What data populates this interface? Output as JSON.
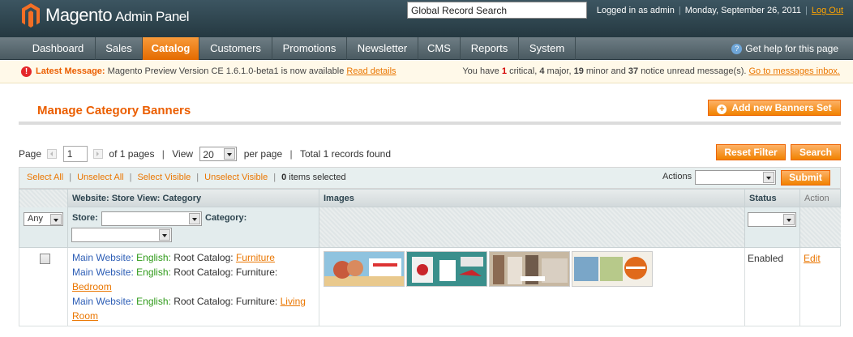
{
  "header": {
    "brand": "Magento",
    "brand_sub": "Admin Panel",
    "search_value": "Global Record Search",
    "logged_in": "Logged in as admin",
    "date": "Monday, September 26, 2011",
    "logout": "Log Out"
  },
  "nav": {
    "items": [
      "Dashboard",
      "Sales",
      "Catalog",
      "Customers",
      "Promotions",
      "Newsletter",
      "CMS",
      "Reports",
      "System"
    ],
    "active": "Catalog",
    "help": "Get help for this page"
  },
  "notice": {
    "label": "Latest Message:",
    "message": "Magento Preview Version CE 1.6.1.0-beta1 is now available",
    "read_details": "Read details",
    "summary_prefix": "You have",
    "critical_count": "1",
    "critical_label": "critical,",
    "major_count": "4",
    "major_label": "major,",
    "minor_count": "19",
    "minor_label": "minor and",
    "notice_count": "37",
    "notice_label": "notice unread message(s).",
    "inbox_link": "Go to messages inbox."
  },
  "page": {
    "title": "Manage Category Banners",
    "add_button": "Add new Banners Set"
  },
  "pager": {
    "page_label": "Page",
    "page_value": "1",
    "of_pages": "of 1 pages",
    "view_label": "View",
    "view_value": "20",
    "per_page": "per page",
    "total": "Total 1 records found",
    "reset_button": "Reset Filter",
    "search_button": "Search"
  },
  "massaction": {
    "select_all": "Select All",
    "unselect_all": "Unselect All",
    "select_visible": "Select Visible",
    "unselect_visible": "Unselect Visible",
    "selected_count": "0",
    "selected_label": "items selected",
    "actions_label": "Actions",
    "submit": "Submit"
  },
  "grid": {
    "columns": [
      "Website: Store View: Category",
      "Images",
      "Status",
      "Action"
    ],
    "filters": {
      "checkbox_filter": "Any",
      "store_label": "Store:",
      "category_label": "Category:"
    },
    "row": {
      "lines": [
        {
          "website": "Main Website:",
          "lang": "English:",
          "path": "Root Catalog:",
          "link": "Furniture"
        },
        {
          "website": "Main Website:",
          "lang": "English:",
          "path": "Root Catalog: Furniture:",
          "link": "Bedroom"
        },
        {
          "website": "Main Website:",
          "lang": "English:",
          "path": "Root Catalog: Furniture:",
          "link": "Living Room"
        }
      ],
      "status": "Enabled",
      "action": "Edit"
    }
  },
  "colors": {
    "accent": "#eb5e00",
    "header_bg": "#2d444f",
    "link": "#ea7601"
  }
}
